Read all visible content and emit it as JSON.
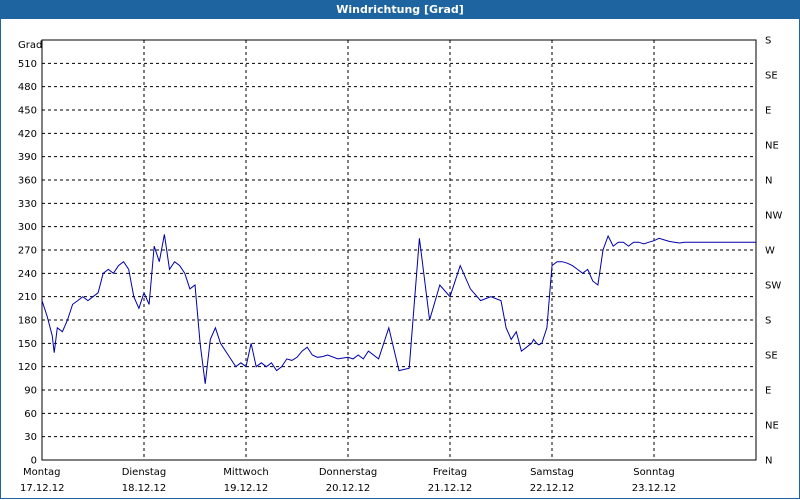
{
  "window": {
    "title": "Windrichtung [Grad]"
  },
  "chart_data": {
    "type": "line",
    "title": "Windrichtung [Grad]",
    "ylabel": "Grad",
    "ylim": [
      0,
      540
    ],
    "y_ticks": [
      0,
      30,
      60,
      90,
      120,
      150,
      180,
      210,
      240,
      270,
      300,
      330,
      360,
      390,
      420,
      450,
      480,
      510
    ],
    "right_axis_labels": [
      "N",
      "NE",
      "E",
      "SE",
      "S",
      "SW",
      "W",
      "NW",
      "N",
      "NE",
      "E",
      "SE",
      "S"
    ],
    "grid": true,
    "line_color": "#0000aa",
    "x_ticks": [
      {
        "day": "Montag",
        "date": "17.12.12"
      },
      {
        "day": "Dienstag",
        "date": "18.12.12"
      },
      {
        "day": "Mittwoch",
        "date": "19.12.12"
      },
      {
        "day": "Donnerstag",
        "date": "20.12.12"
      },
      {
        "day": "Freitag",
        "date": "21.12.12"
      },
      {
        "day": "Samstag",
        "date": "22.12.12"
      },
      {
        "day": "Sonntag",
        "date": "23.12.12"
      }
    ],
    "xlim_days": [
      0,
      7
    ],
    "series": [
      {
        "x": [
          0,
          0.05,
          0.1,
          0.12,
          0.15,
          0.2,
          0.25,
          0.3,
          0.35,
          0.4,
          0.45,
          0.5,
          0.55,
          0.6,
          0.65,
          0.7,
          0.75,
          0.8,
          0.85,
          0.9,
          0.95,
          1.0,
          1.05,
          1.1,
          1.15,
          1.2,
          1.25,
          1.3,
          1.35,
          1.4,
          1.45,
          1.5,
          1.55,
          1.6,
          1.65,
          1.7,
          1.75,
          1.8,
          1.85,
          1.9,
          1.95,
          2.0,
          2.05,
          2.1,
          2.15,
          2.2,
          2.25,
          2.3,
          2.35,
          2.4,
          2.45,
          2.5,
          2.55,
          2.6,
          2.65,
          2.7,
          2.75,
          2.8,
          2.9,
          3.0,
          3.05,
          3.1,
          3.15,
          3.2,
          3.3,
          3.4,
          3.5,
          3.6,
          3.7,
          3.8,
          3.9,
          4.0,
          4.1,
          4.2,
          4.3,
          4.4,
          4.5,
          4.55,
          4.6,
          4.65,
          4.7,
          4.75,
          4.8,
          4.82,
          4.85,
          4.87,
          4.9,
          4.95,
          5.0,
          5.05,
          5.1,
          5.15,
          5.2,
          5.25,
          5.3,
          5.35,
          5.4,
          5.45,
          5.5,
          5.55,
          5.6,
          5.65,
          5.7,
          5.75,
          5.8,
          5.85,
          5.9,
          5.95,
          6.0,
          6.05,
          6.1,
          6.15,
          6.2,
          6.25,
          6.3,
          6.35,
          6.4,
          6.45,
          6.5,
          6.55,
          6.6,
          6.65,
          6.7,
          6.75,
          6.8,
          6.85,
          6.9,
          6.95,
          7.0
        ],
        "y": [
          205,
          185,
          160,
          138,
          170,
          165,
          180,
          200,
          205,
          210,
          205,
          210,
          215,
          240,
          245,
          240,
          250,
          255,
          245,
          210,
          195,
          215,
          200,
          275,
          255,
          290,
          245,
          255,
          250,
          240,
          220,
          225,
          150,
          98,
          155,
          170,
          150,
          140,
          130,
          120,
          125,
          120,
          150,
          120,
          125,
          120,
          125,
          115,
          120,
          130,
          128,
          132,
          140,
          145,
          135,
          132,
          133,
          135,
          130,
          132,
          130,
          135,
          130,
          140,
          130,
          170,
          115,
          118,
          285,
          180,
          225,
          210,
          250,
          220,
          205,
          210,
          205,
          170,
          155,
          165,
          140,
          145,
          150,
          155,
          150,
          148,
          150,
          170,
          250,
          255,
          255,
          253,
          250,
          245,
          240,
          245,
          230,
          225,
          270,
          288,
          275,
          280,
          280,
          275,
          280,
          280,
          278,
          280,
          282,
          285,
          283,
          281,
          280,
          279,
          280,
          280,
          280,
          280,
          280,
          280,
          280,
          280,
          280,
          280,
          280,
          280,
          280,
          280,
          280
        ]
      }
    ]
  }
}
